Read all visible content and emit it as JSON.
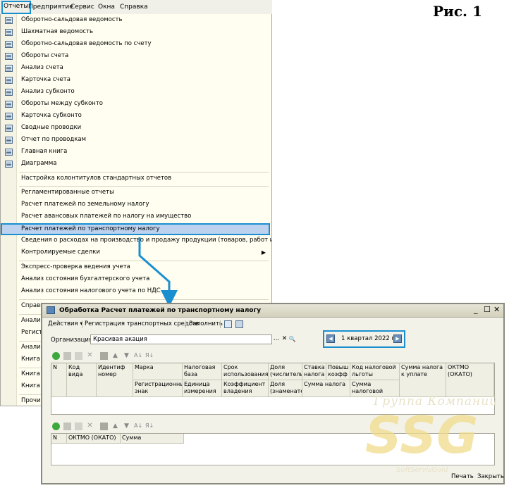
{
  "figure_label": "Рис. 1",
  "menubar": [
    "Отчеты",
    "Предприятие",
    "Сервис",
    "Окна",
    "Справка"
  ],
  "dropdown": {
    "group1": [
      "Оборотно-сальдовая ведомость",
      "Шахматная ведомость",
      "Оборотно-сальдовая ведомость по счету",
      "Обороты счета",
      "Анализ счета",
      "Карточка счета",
      "Анализ субконто",
      "Обороты между субконто",
      "Карточка субконто",
      "Сводные проводки",
      "Отчет по проводкам",
      "Главная книга",
      "Диаграмма"
    ],
    "group2": [
      "Настройка колонтитулов стандартных отчетов"
    ],
    "group3": [
      "Регламентированные отчеты",
      "Расчет платежей по земельному налогу",
      "Расчет авансовых платежей по налогу на имущество",
      "Расчет платежей по транспортному налогу",
      "Сведения о расходах на производство и продажу продукции (товаров, работ и услуг)",
      "Контролируемые сделки"
    ],
    "group4": [
      "Экспресс-проверка ведения учета",
      "Анализ состояния бухгалтерского учета",
      "Анализ состояния налогового учета по НДС"
    ],
    "truncated": [
      "Справк",
      "Анализ",
      "Регистр",
      "Анализ",
      "Книга у",
      "Книга у",
      "Книга у",
      "Прочие"
    ]
  },
  "window": {
    "title": "Обработка  Расчет платежей по транспортному налогу",
    "toolbar": {
      "actions": "Действия ▾",
      "register": "Регистрация транспортных средств",
      "fill": "Заполнить"
    },
    "org_label": "Организация:",
    "org_value": "Красивая акация",
    "org_btn_choose": "...",
    "org_btn_clear": "✕",
    "org_btn_search": "🔍",
    "period": "1 квартал 2022 г.",
    "grid1_headers_row1": [
      "N",
      "Код вида",
      "Идентиф номер",
      "Марка",
      "Налоговая база",
      "Срок использования",
      "Доля (числитель)",
      "Ставка налога",
      "Повыш коэфф",
      "Код налоговой льготы",
      "Сумма налога к уплате",
      "ОКТМО (ОКАТО)"
    ],
    "grid1_headers_row2": [
      "Регистрационный знак",
      "Единица измерения",
      "Коэффициент владения",
      "Доля (знаменате",
      "Сумма налога",
      "Сумма налоговой"
    ],
    "grid2_headers": [
      "N",
      "ОКТМО (ОКАТО)",
      "Сумма"
    ],
    "bottom": {
      "print": "Печать",
      "close": "Закрыть"
    }
  },
  "watermark": {
    "top": "Группа Компаний",
    "main": "SSG",
    "bottom": "SoftServisGold"
  },
  "colors": {
    "highlight_border": "#1a8fd0",
    "selection": "#bcd2ef",
    "menu_bg": "#fffef0"
  }
}
